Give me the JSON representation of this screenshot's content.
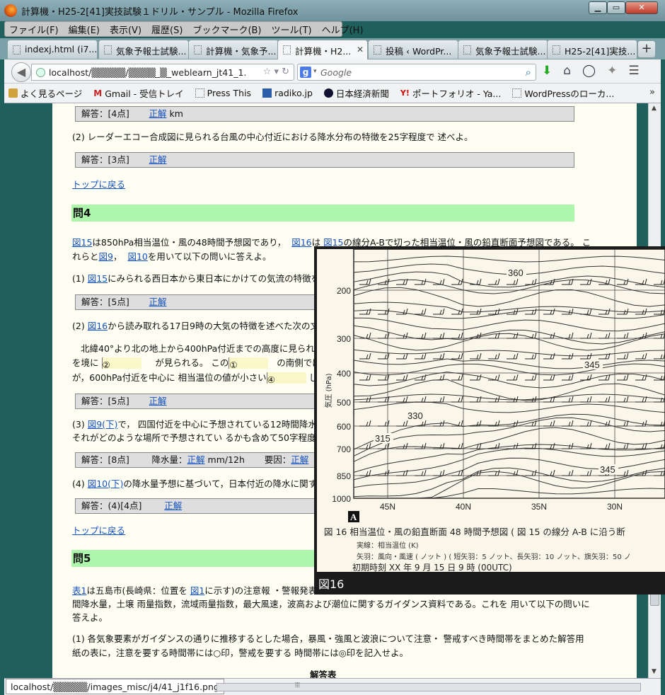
{
  "window": {
    "title": "計算機・H25-2[41]実技試験１ドリル・サンプル - Mozilla Firefox",
    "btn_min": "▁",
    "btn_max": "▭",
    "btn_close": "✕"
  },
  "menu": [
    "ファイル(F)",
    "編集(E)",
    "表示(V)",
    "履歴(S)",
    "ブックマーク(B)",
    "ツール(T)",
    "ヘルプ(H)"
  ],
  "tabs": [
    {
      "label": "indexj.html (i7..."
    },
    {
      "label": "気象予報士試験..."
    },
    {
      "label": "計算機・気象予..."
    },
    {
      "label": "計算機・H2...",
      "active": true
    },
    {
      "label": "投稿 ‹ WordPr..."
    },
    {
      "label": "気象予報士試験..."
    },
    {
      "label": "H25-2[41]実技..."
    }
  ],
  "tab_close": "✕",
  "new_tab": "+",
  "nav": {
    "back": "◀",
    "url": "localhost/▒▒▒▒▒/▒▒▒▒_▒_weblearn_jt41_1.htm",
    "url_icons": "☆ ▾ ↻",
    "search_placeholder": "Google",
    "search_engine": "g",
    "search_dropdown": "▾",
    "search_icon": "⌕"
  },
  "nav_icons": {
    "download": "⬇",
    "home": "⌂",
    "sync": "◯",
    "ext": "✦",
    "menu": "☰"
  },
  "bookmarks": [
    {
      "label": "よく見るページ",
      "icon": "star"
    },
    {
      "label": "Gmail - 受信トレイ",
      "icon": "mail",
      "glyph": "M"
    },
    {
      "label": "Press This",
      "icon": "page"
    },
    {
      "label": "radiko.jp",
      "icon": "rad"
    },
    {
      "label": "日本経済新聞",
      "icon": "nik"
    },
    {
      "label": "ポートフォリオ - Ya...",
      "icon": "yah",
      "glyph": "Y!"
    },
    {
      "label": "WordPressのローカ...",
      "icon": "page"
    }
  ],
  "bookmarks_more": "»",
  "content": {
    "ans1_label": "解答：[4点]",
    "ans_link": "正解",
    "ans1_unit": "km",
    "q2_text": "(2) レーダーエコー合成図に見られる台風の中心付近における降水分布の特徴を25字程度で 述べよ。",
    "ans2_label": "解答：[3点]",
    "top_link": "トップに戻る",
    "q4_header": "問4",
    "q4_intro_a": "図15",
    "q4_intro_b": "は850hPa相当温位・風の48時間予想図であり，",
    "q4_intro_c": "図16",
    "q4_intro_d": "は",
    "q4_intro_e": "図15",
    "q4_intro_f": "の線分A-Bで切った相当温位・風の鉛直断面予想図である。 こ",
    "q4_intro2_a": "れらと",
    "q4_intro2_b": "図9",
    "q4_intro2_c": "，",
    "q4_intro2_d": "図10",
    "q4_intro2_e": "を用いて以下の問いに答えよ。",
    "q4_1_a": "(1) ",
    "q4_1_b": "図15",
    "q4_1_c": "にみられる西日本から東日本にかけての気流の特徴を，",
    "ans3_label": "解答：[5点]",
    "q4_2_a": "(2) ",
    "q4_2_b": "図16",
    "q4_2_c": "から読み取れる17日9時の大気の特徴を述べた次の文章",
    "q4_2_p1": "北緯40°より北の地上から400hPa付近までの高度に見られる",
    "q4_2_p2a": "を境に",
    "q4_2_blank2": "②",
    "q4_2_p2b": "が見られる。 この",
    "q4_2_blank1": "①",
    "q4_2_p2c": "の南側では850",
    "q4_2_p3a": "が，600hPa付近を中心に 相当温位の値が小さい",
    "q4_2_blank4": "④",
    "q4_2_p3b": "した",
    "ans4_label": "解答：[5点]",
    "q4_3_a": "(3) ",
    "q4_3_b": "図9(下)",
    "q4_3_c": "で， 四国付近を中心に予想されている12時間降水量",
    "q4_3_line2": "それがどのような場所で予想されてい るかも含めて50字程度で",
    "ans5_label": "解答：[8点]",
    "ans5_rain": "降水量：",
    "ans5_unit": "mm/12h",
    "ans5_cause": "要因：",
    "q4_4_a": "(4) ",
    "q4_4_b": "図10(下)",
    "q4_4_c": "の降水量予想に基づいて，日本付近の降水に関す",
    "ans6_label": "解答：(4)[4点]",
    "q5_header": "問5",
    "q5_a": "表1",
    "q5_b": "は五島市(長崎県：位置を",
    "q5_c": "図1",
    "q5_d": "に示す)の注意報 ・警報発表基",
    "q5_line2": "間降水量，土壌 雨量指数，流域雨量指数，最大風速，波高および潮位に関するガイダンス資料である。これを 用いて以下の問いに",
    "q5_line3": "答えよ。",
    "q5_1_line1": "(1) 各気象要素がガイダンスの通りに推移するとした場合，暴風・強風と波浪について注意・ 警戒すべき時間帯をまとめた解答用",
    "q5_1_line2": "紙の表に，注意を要する時間帯には○印，警戒を要する 時間帯には◎印を記入せよ。",
    "answer_table_title": "解答表"
  },
  "figure": {
    "y_ticks": [
      "200",
      "300",
      "400",
      "500",
      "600",
      "700",
      "850",
      "1000"
    ],
    "y_axis_label": "気圧 (hPa)",
    "x_ticks": [
      "45N",
      "40N",
      "35N",
      "30N"
    ],
    "contour_labels": [
      "360",
      "345",
      "330",
      "315",
      "345"
    ],
    "marker": "A",
    "caption": "図 16  相当温位・風の鉛直断面 48 時間予想図 ( 図 15 の線分 A-B に沿う断",
    "note1": "実線：相当温位 (K)",
    "note2": "矢羽：風向・風速 ( ノット ) ( 短矢羽：5 ノット、長矢羽：10 ノット、旗矢羽：50 ノ",
    "note3": "初期時刻    XX 年 9 月 15 日 9 時 (00UTC)",
    "label": "図16"
  },
  "status": {
    "url": "localhost/▒▒▒▒▒/images_misc/j4/41_j1f16.png",
    "grip": "⦙⦙⦙"
  }
}
